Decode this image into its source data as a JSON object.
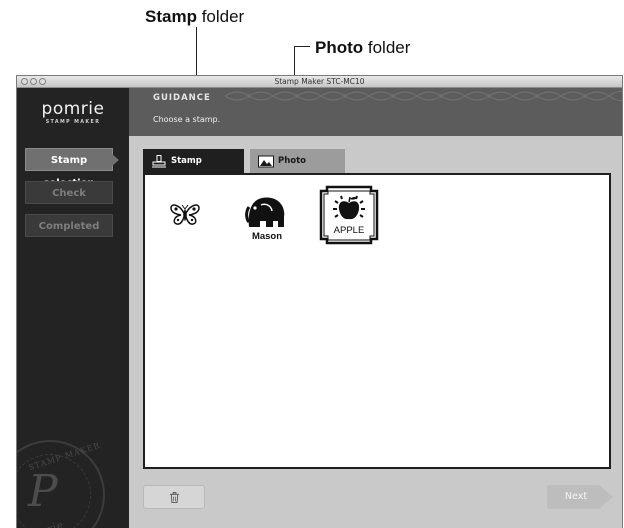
{
  "callouts": {
    "stamp": {
      "bold": "Stamp",
      "rest": " folder"
    },
    "photo": {
      "bold": "Photo",
      "rest": " folder"
    }
  },
  "window": {
    "title": "Stamp Maker STC-MC10"
  },
  "sidebar": {
    "logo": "pomrie",
    "logo_sub": "STAMP MAKER",
    "steps": [
      {
        "label": "Stamp selection",
        "state": "active"
      },
      {
        "label": "Check",
        "state": "inactive"
      },
      {
        "label": "Completed",
        "state": "inactive"
      }
    ],
    "seal": {
      "top_text": "STAMP MAKER",
      "bottom_text": "Pomrie",
      "glyph": "P"
    }
  },
  "guidance": {
    "title": "GUIDANCE",
    "text": "Choose a stamp."
  },
  "tabs": [
    {
      "label": "Stamp",
      "icon": "stamp-icon",
      "active": true
    },
    {
      "label": "Photo",
      "icon": "photo-icon",
      "active": false
    }
  ],
  "stamps": [
    {
      "name": "butterfly",
      "text": ""
    },
    {
      "name": "elephant",
      "text": "Mason"
    },
    {
      "name": "apple",
      "text": "APPLE"
    }
  ],
  "footer": {
    "trash_icon": "trash-icon",
    "next_label": "Next"
  },
  "colors": {
    "accent_active": "#707070",
    "panel_border": "#1f1f1f",
    "guidance_bg": "#5c5c5c"
  }
}
